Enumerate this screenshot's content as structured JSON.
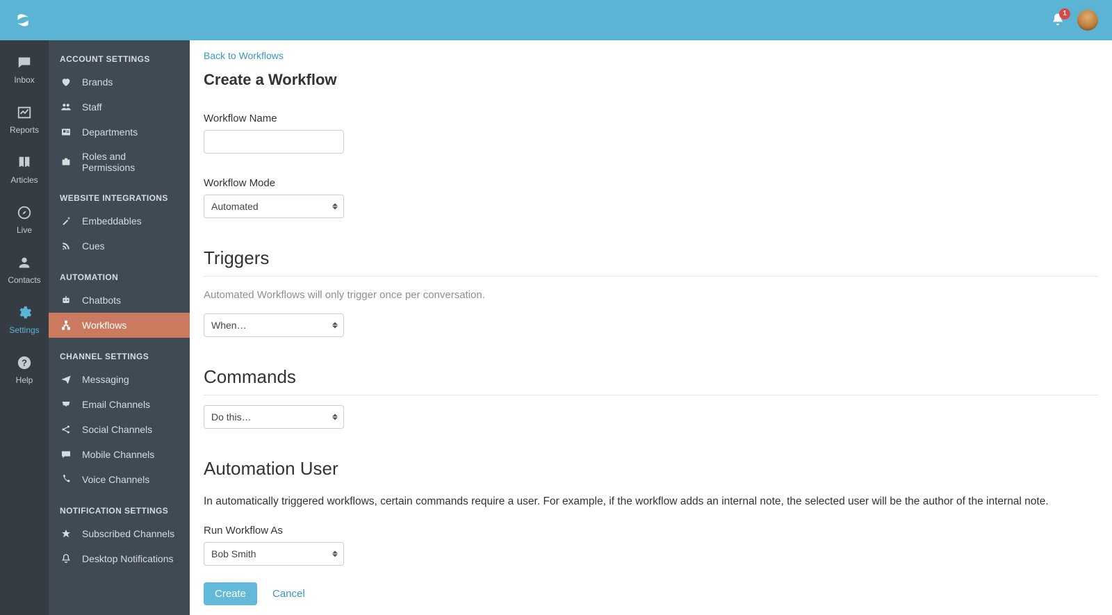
{
  "topbar": {
    "notification_count": "1"
  },
  "nav_rail": {
    "items": [
      {
        "label": "Inbox"
      },
      {
        "label": "Reports"
      },
      {
        "label": "Articles"
      },
      {
        "label": "Live"
      },
      {
        "label": "Contacts"
      },
      {
        "label": "Settings"
      },
      {
        "label": "Help"
      }
    ]
  },
  "sidebar": {
    "sections": [
      {
        "title": "ACCOUNT SETTINGS",
        "items": [
          "Brands",
          "Staff",
          "Departments",
          "Roles and Permissions"
        ]
      },
      {
        "title": "WEBSITE INTEGRATIONS",
        "items": [
          "Embeddables",
          "Cues"
        ]
      },
      {
        "title": "AUTOMATION",
        "items": [
          "Chatbots",
          "Workflows"
        ]
      },
      {
        "title": "CHANNEL SETTINGS",
        "items": [
          "Messaging",
          "Email Channels",
          "Social Channels",
          "Mobile Channels",
          "Voice Channels"
        ]
      },
      {
        "title": "NOTIFICATION SETTINGS",
        "items": [
          "Subscribed Channels",
          "Desktop Notifications"
        ]
      }
    ]
  },
  "form": {
    "back_link": "Back to Workflows",
    "page_title": "Create a Workflow",
    "name_label": "Workflow Name",
    "name_value": "",
    "mode_label": "Workflow Mode",
    "mode_value": "Automated",
    "triggers_heading": "Triggers",
    "triggers_helper": "Automated Workflows will only trigger once per conversation.",
    "trigger_value": "When…",
    "commands_heading": "Commands",
    "command_value": "Do this…",
    "automation_user_heading": "Automation User",
    "automation_user_text": "In automatically triggered workflows, certain commands require a user. For example, if the workflow adds an internal note, the selected user will be the author of the internal note.",
    "run_as_label": "Run Workflow As",
    "run_as_value": "Bob Smith",
    "create_button": "Create",
    "cancel_button": "Cancel"
  }
}
